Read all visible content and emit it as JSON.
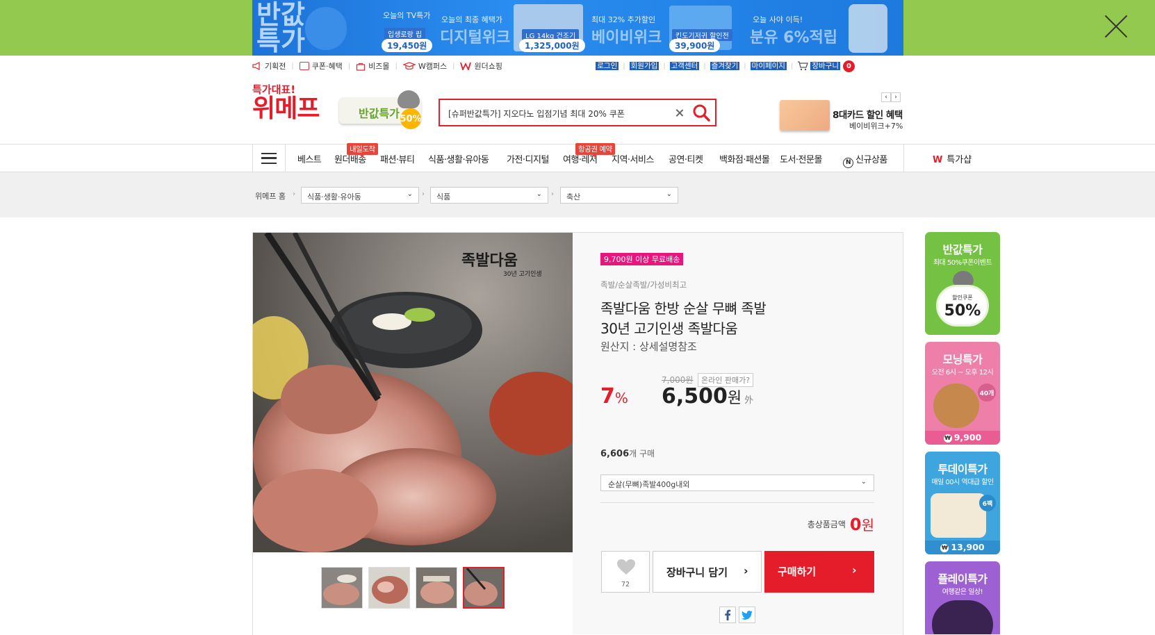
{
  "banner": {
    "left_title_1": "반값",
    "left_title_2": "특가",
    "seg1_label": "오늘의 TV특가",
    "seg1_product": "입생로랑 립",
    "seg1_price": "19,450원",
    "seg2_small": "오늘의 최종 혜택가",
    "seg2_title": "디지털위크",
    "seg2_product": "LG 14kg 건조기",
    "seg2_price": "1,325,000원",
    "seg3_small": "최대 32% 추가할인",
    "seg3_title": "베이비위크",
    "seg3_product": "킨도기저귀 할인전",
    "seg3_price": "39,900원",
    "seg4_small": "오늘 사야 이득!",
    "seg4_title": "분유 6%적립",
    "bg_color": "#92c94e",
    "close_icon": "close-icon"
  },
  "util_left": [
    {
      "icon": "megaphone-icon",
      "label": "기획전"
    },
    {
      "icon": "coupon-icon",
      "label": "쿠폰·혜택"
    },
    {
      "icon": "bag-icon",
      "label": "비즈몰"
    },
    {
      "icon": "graduation-cap-icon",
      "label": "W캠퍼스"
    },
    {
      "icon": "w-logo-icon",
      "label": "원더쇼핑"
    }
  ],
  "util_right": {
    "login": "로그인",
    "signup": "회원가입",
    "support": "고객센터",
    "favorites": "즐겨찾기",
    "mypage": "마이페이지",
    "cart": "장바구니",
    "cart_count": "0"
  },
  "header": {
    "logo_sub": "특가대표!",
    "logo_main": "위메프",
    "promo_text": "반값특가",
    "promo_pct": "50%",
    "search_value": "[슈퍼반값특가] 지오다노 입점기념 최대 20% 쿠폰",
    "card_ad_title": "8대카드 할인 혜택",
    "card_ad_sub": "베이비위크+7%"
  },
  "gnb": {
    "best": "베스트",
    "wonder_delivery": "원더배송",
    "wonder_delivery_flag": "내일도착",
    "fashion": "패션·뷰티",
    "food": "식품·생활·유아동",
    "digital": "가전·디지털",
    "travel": "여행·레저",
    "travel_flag": "항공권 예약",
    "local": "지역·서비스",
    "ticket": "공연·티켓",
    "department": "백화점·패션몰",
    "books": "도서·전문몰",
    "new": "신규상품",
    "new_badge": "N",
    "wshop_w": "W",
    "wshop": "특가샵"
  },
  "breadcrumb": {
    "home": "위메프 홈",
    "level1": "식품·생활·유아동",
    "level2": "식품",
    "level3": "축산"
  },
  "product": {
    "free_shipping": "9,700원 이상 무료배송",
    "subcategory": "족발/순살족발/가성비최고",
    "title_line1": "족발다움 한방 순살 무뼈 족발",
    "title_line2": "30년 고기인생 족발다움",
    "origin": "원산지 : 상세설명참조",
    "discount_value": "7",
    "discount_unit": "%",
    "original_price": "7,000원",
    "online_price_q": "온라인 판매가?",
    "price": "6,500",
    "price_unit": "원",
    "price_etc": "外",
    "sold_count": "6,606",
    "sold_unit": "개 구매",
    "option": "순살(무뼈)족발400g내외",
    "total_label": "총상품금액",
    "total_amount": "0",
    "total_unit": "원",
    "like_count": "72",
    "cart_label": "장바구니 담기",
    "buy_label": "구매하기",
    "image_brand": "족발다움",
    "image_brand_sub": "30년 고기인생",
    "thumb_count": 4,
    "active_thumb": 4
  },
  "side_promos": [
    {
      "title": "반값특가",
      "sub": "최대 50%쿠폰이벤트",
      "inner_label": "할인쿠폰",
      "inner_value": "50%",
      "color": "#75c143"
    },
    {
      "title": "모닝특가",
      "sub": "오전 6시 ~ 오후 12시",
      "count_badge": "40개",
      "price": "9,900",
      "color": "#ee7fa8"
    },
    {
      "title": "투데이특가",
      "sub": "매일 00시 역대급 할인",
      "count_badge": "6팩",
      "price": "13,900",
      "color": "#3fa5df"
    },
    {
      "title": "플레이특가",
      "sub": "여행같은 일상!",
      "color": "#9d61d3"
    }
  ]
}
